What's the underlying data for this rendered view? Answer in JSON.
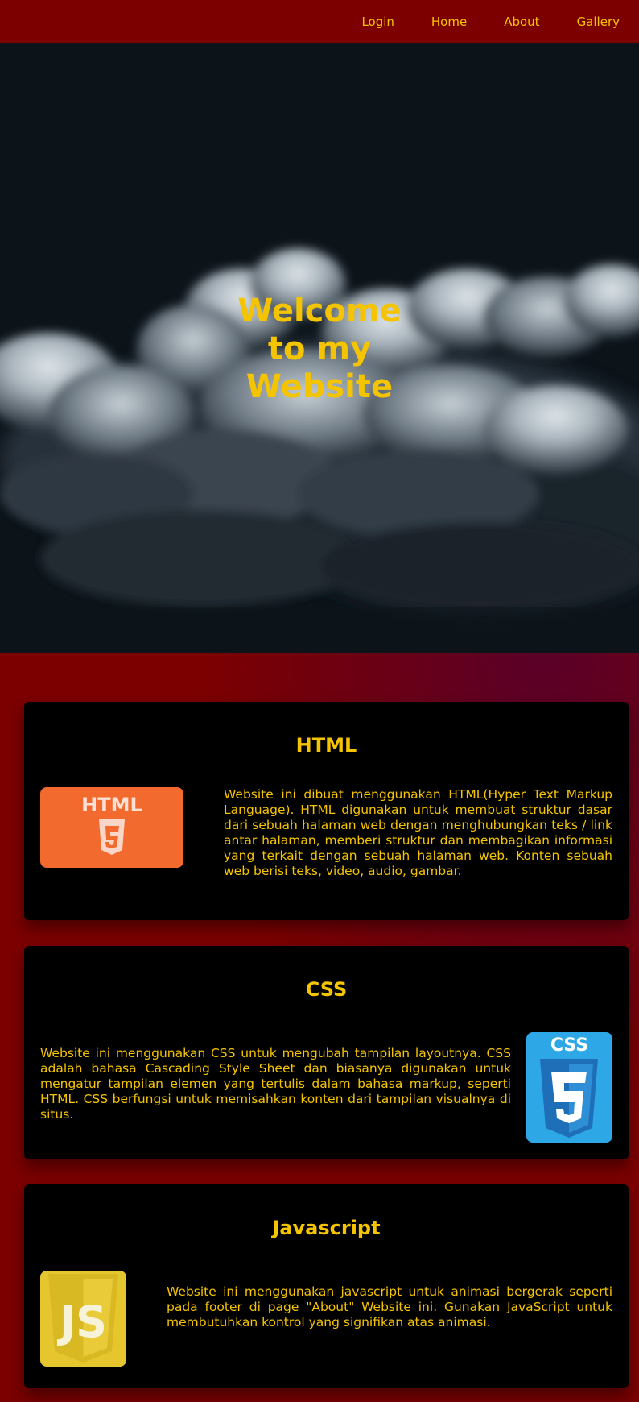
{
  "nav": {
    "items": [
      {
        "label": "Login"
      },
      {
        "label": "Home"
      },
      {
        "label": "About"
      },
      {
        "label": "Gallery"
      }
    ]
  },
  "hero": {
    "title_lines": [
      "Welcome",
      "to my",
      "Website"
    ]
  },
  "cards": [
    {
      "title": "HTML",
      "logo": "html5-logo",
      "logo_text": "HTML",
      "text": "Website ini dibuat menggunakan HTML(Hyper Text Markup Language). HTML digunakan untuk membuat struktur dasar dari sebuah halaman web dengan menghubungkan teks / link antar halaman, memberi struktur dan membagikan informasi yang terkait dengan sebuah halaman web. Konten sebuah web berisi teks, video, audio, gambar."
    },
    {
      "title": "CSS",
      "logo": "css3-logo",
      "logo_text": "CSS",
      "text": "Website ini menggunakan CSS untuk mengubah tampilan layoutnya. CSS adalah bahasa Cascading Style Sheet dan biasanya digunakan untuk mengatur tampilan elemen yang tertulis dalam bahasa markup, seperti HTML. CSS berfungsi untuk memisahkan konten dari tampilan visualnya di situs."
    },
    {
      "title": "Javascript",
      "logo": "javascript-logo",
      "logo_text": "JS",
      "text": "Website ini menggunakan javascript untuk animasi bergerak seperti pada footer di page \"About\" Website ini. Gunakan JavaScript untuk membutuhkan kontrol yang signifikan atas animasi."
    }
  ],
  "colors": {
    "accent": "#f5c400",
    "navbar": "#7d0000",
    "page_bg": "#7c0000",
    "card_bg": "#000000",
    "html5_orange": "#f26a2e",
    "css3_blue": "#2ea7e6",
    "js_yellow": "#e6c62e"
  }
}
